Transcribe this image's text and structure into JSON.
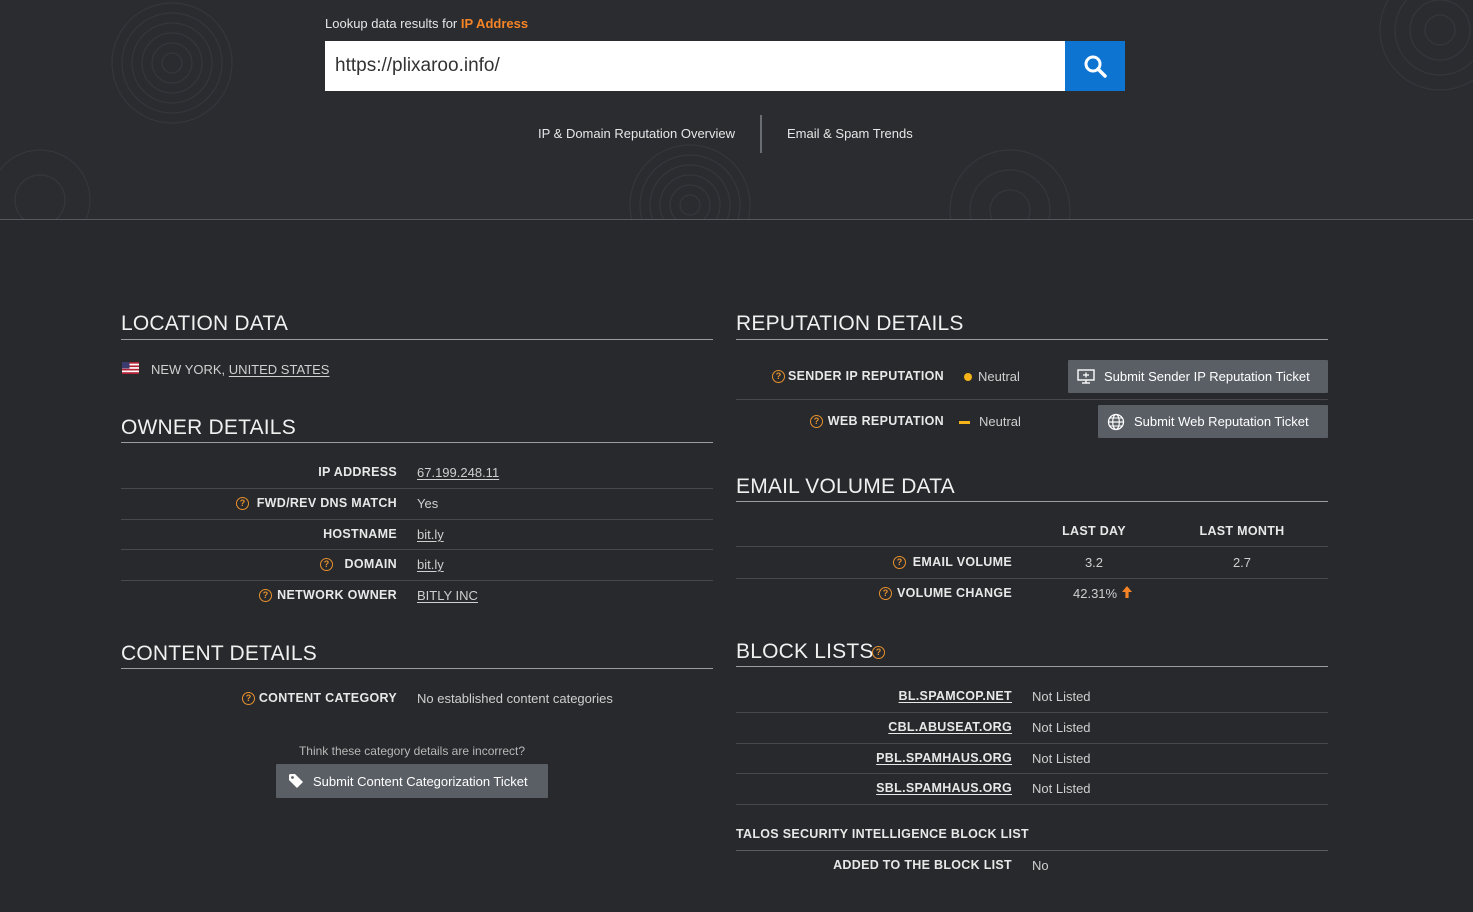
{
  "search": {
    "label_prefix": "Lookup data results for",
    "label_type": "IP Address",
    "value": "https://plixaroo.info/"
  },
  "nav": {
    "overview": "IP & Domain Reputation Overview",
    "trends": "Email & Spam Trends"
  },
  "location": {
    "title": "LOCATION DATA",
    "city": "NEW YORK,",
    "country": "UNITED STATES"
  },
  "owner": {
    "title": "OWNER DETAILS",
    "rows": [
      {
        "label": "IP ADDRESS",
        "value": "67.199.248.11"
      },
      {
        "label": "FWD/REV DNS MATCH",
        "value": "Yes"
      },
      {
        "label": "HOSTNAME",
        "value": "bit.ly"
      },
      {
        "label": "DOMAIN",
        "value": "bit.ly"
      },
      {
        "label": "NETWORK OWNER",
        "value": "BITLY INC"
      }
    ]
  },
  "content": {
    "title": "CONTENT DETAILS",
    "category_label": "CONTENT CATEGORY",
    "category_value": "No established content categories",
    "incorrect_prompt": "Think these category details are incorrect?",
    "ticket_button": "Submit Content Categorization Ticket"
  },
  "reputation": {
    "title": "REPUTATION DETAILS",
    "sender_label": "SENDER IP REPUTATION",
    "sender_value": "Neutral",
    "sender_button": "Submit Sender IP Reputation Ticket",
    "web_label": "WEB REPUTATION",
    "web_value": "Neutral",
    "web_button": "Submit Web Reputation Ticket",
    "status_color": "#f5b31a"
  },
  "email_volume": {
    "title": "EMAIL VOLUME DATA",
    "col_day": "LAST DAY",
    "col_month": "LAST MONTH",
    "volume_label": "EMAIL VOLUME",
    "volume_day": "3.2",
    "volume_month": "2.7",
    "change_label": "VOLUME CHANGE",
    "change_value": "42.31%"
  },
  "block_lists": {
    "title": "BLOCK LISTS",
    "rows": [
      {
        "name": "BL.SPAMCOP.NET",
        "status": "Not Listed"
      },
      {
        "name": "CBL.ABUSEAT.ORG",
        "status": "Not Listed"
      },
      {
        "name": "PBL.SPAMHAUS.ORG",
        "status": "Not Listed"
      },
      {
        "name": "SBL.SPAMHAUS.ORG",
        "status": "Not Listed"
      }
    ],
    "talos_title": "TALOS SECURITY INTELLIGENCE BLOCK LIST",
    "added_label": "ADDED TO THE BLOCK LIST",
    "added_value": "No"
  },
  "colors": {
    "accent": "#f58426",
    "search_button": "#0d74d1",
    "background": "#27292c"
  }
}
